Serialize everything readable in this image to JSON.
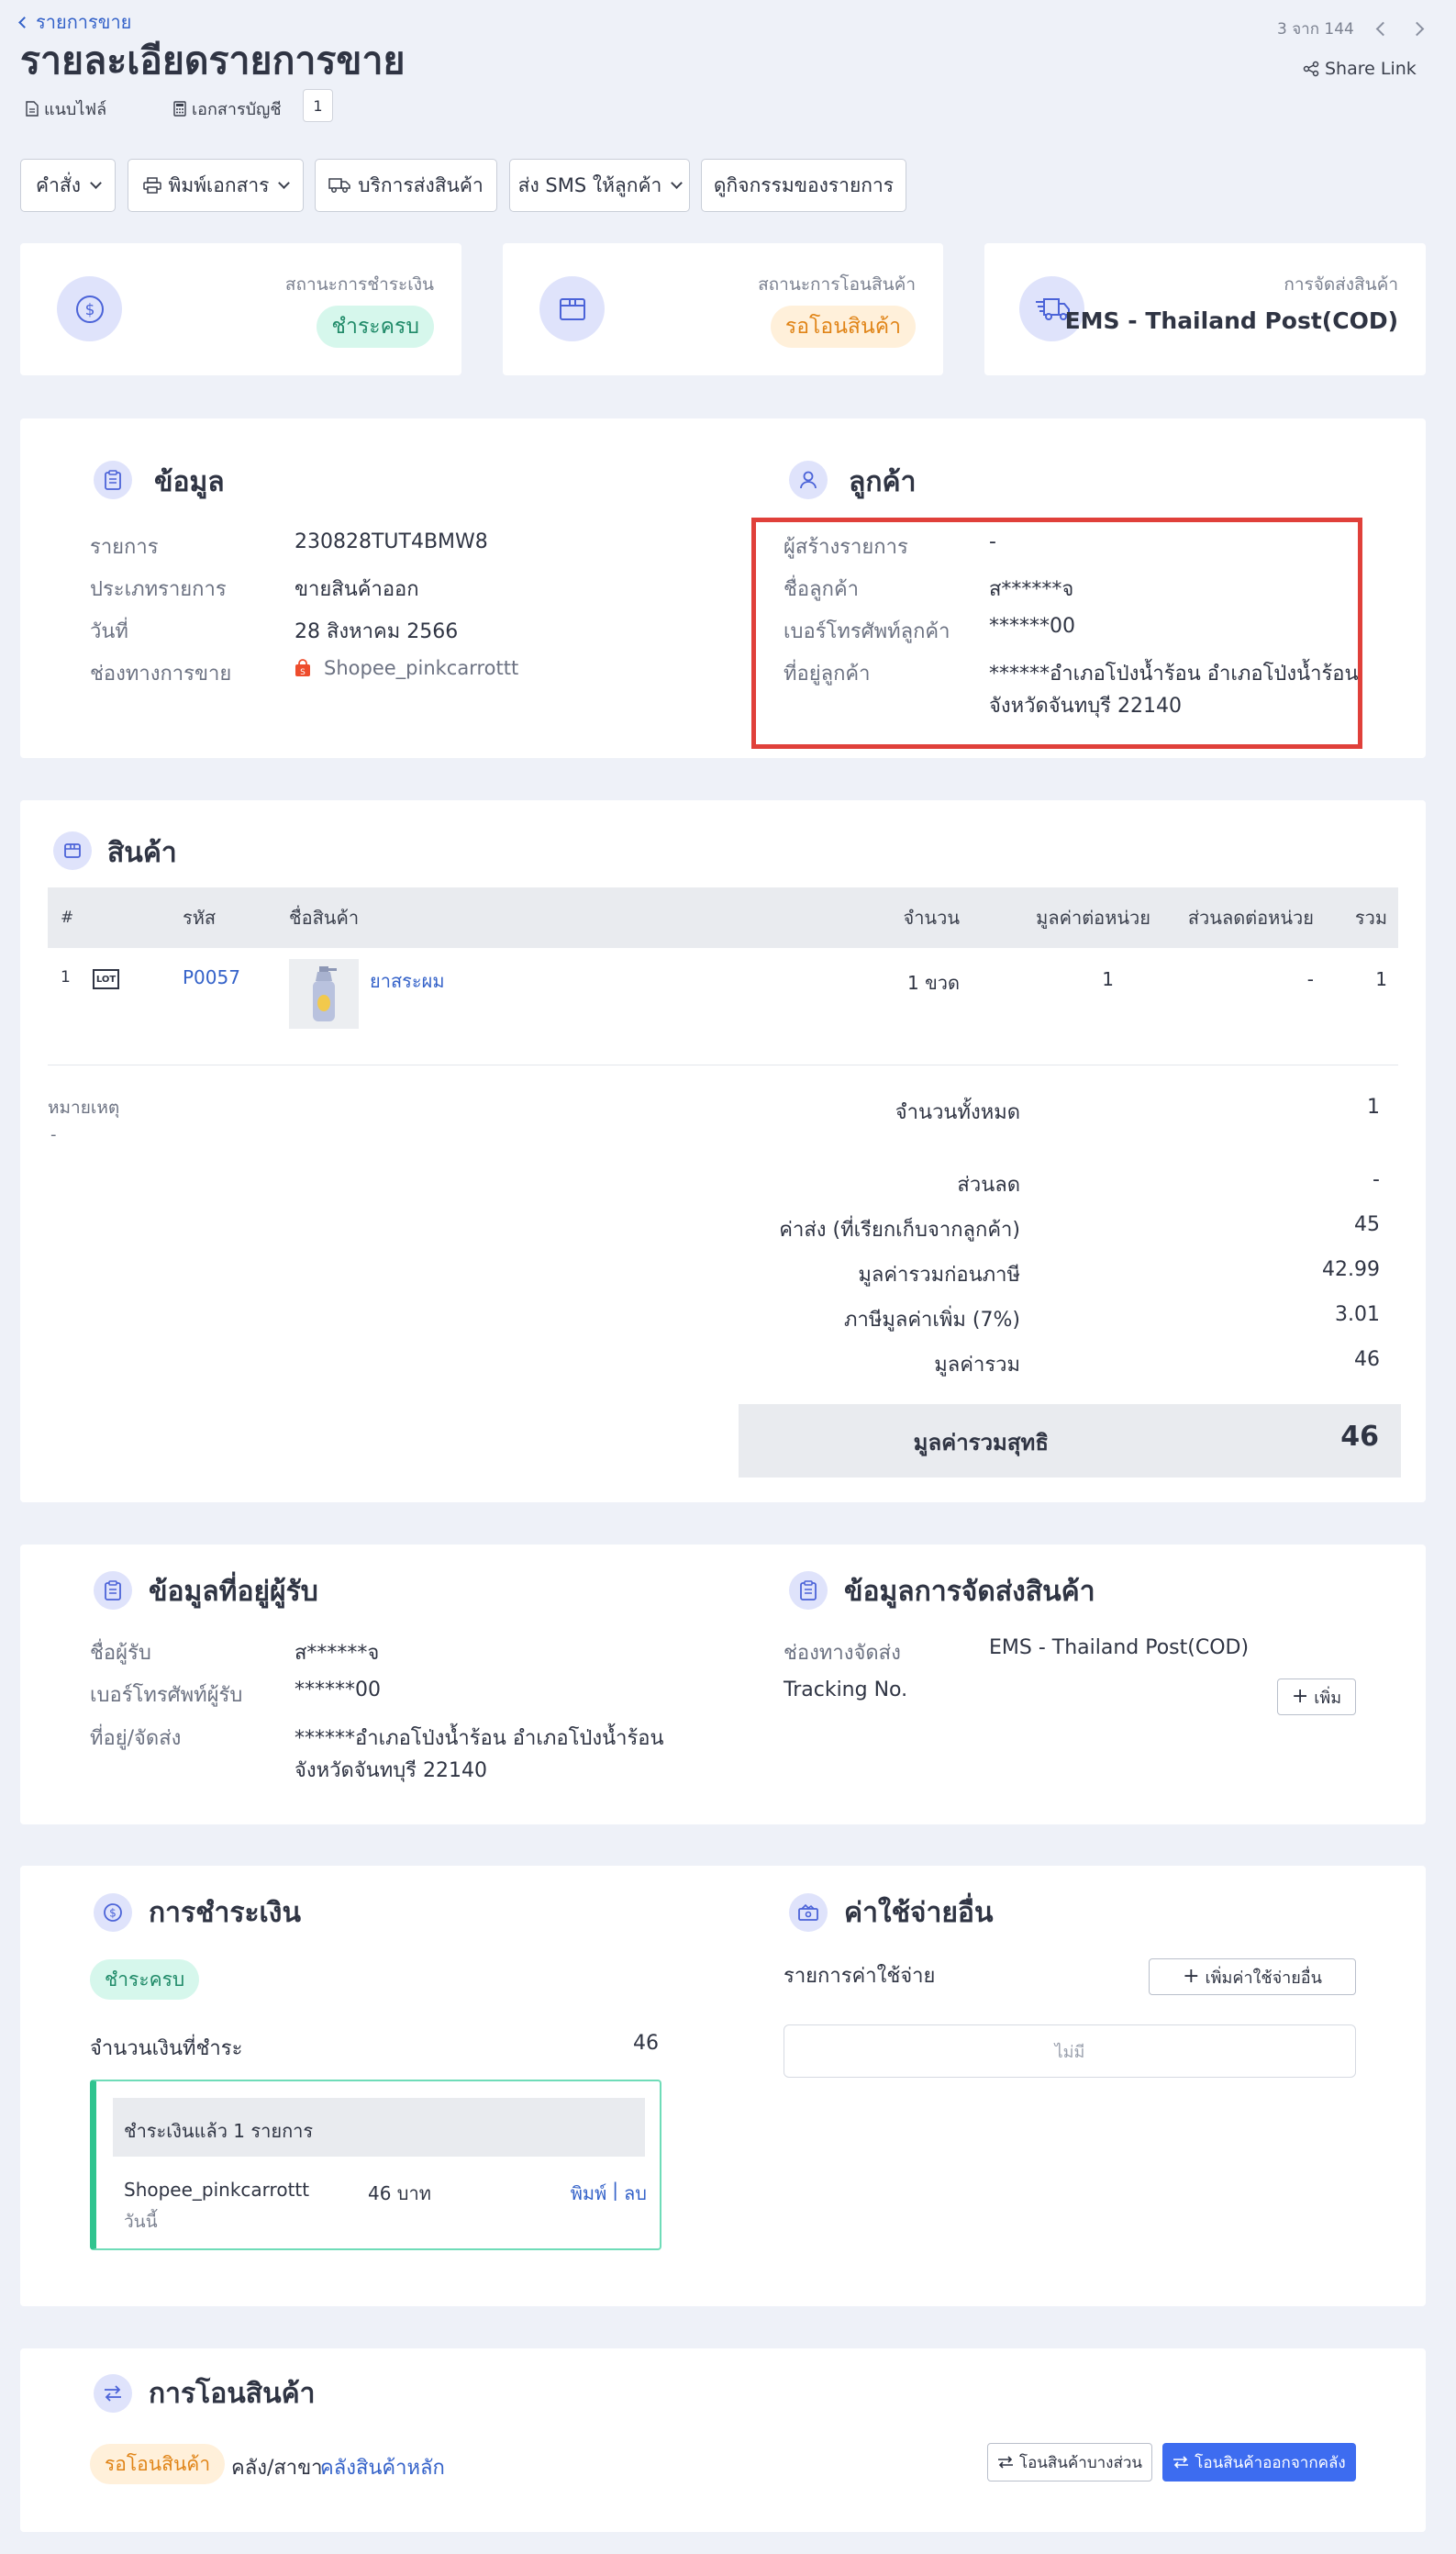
{
  "header": {
    "breadcrumb": "รายการขาย",
    "title": "รายละเอียดรายการขาย",
    "pager": "3 จาก 144",
    "share_link": "Share Link",
    "attach_label": "แนบไฟล์",
    "doc_label": "เอกสารบัญชี",
    "doc_count": "1"
  },
  "toolbar": {
    "command": "คำสั่ง",
    "print": "พิมพ์เอกสาร",
    "shipping_service": "บริการส่งสินค้า",
    "sms": "ส่ง SMS ให้ลูกค้า",
    "activity": "ดูกิจกรรมของรายการ"
  },
  "status": {
    "payment_label": "สถานะการชำระเงิน",
    "payment_value": "ชำระครบ",
    "transfer_label": "สถานะการโอนสินค้า",
    "transfer_value": "รอโอนสินค้า",
    "shipping_label": "การจัดส่งสินค้า",
    "shipping_value": "EMS - Thailand Post(COD)"
  },
  "info": {
    "title": "ข้อมูล",
    "rows": [
      {
        "label": "รายการ",
        "value": "230828TUT4BMW8"
      },
      {
        "label": "ประเภทรายการ",
        "value": "ขายสินค้าออก"
      },
      {
        "label": "วันที่",
        "value": "28 สิงหาคม 2566"
      },
      {
        "label": "ช่องทางการขาย",
        "value": "Shopee_pinkcarrottt"
      }
    ]
  },
  "customer": {
    "title": "ลูกค้า",
    "rows": [
      {
        "label": "ผู้สร้างรายการ",
        "value": "-"
      },
      {
        "label": "ชื่อลูกค้า",
        "value": "ส******จ"
      },
      {
        "label": "เบอร์โทรศัพท์ลูกค้า",
        "value": "******00"
      },
      {
        "label": "ที่อยู่ลูกค้า",
        "value": "******อำเภอโป่งน้ำร้อน อำเภอโป่งน้ำร้อน",
        "value2": "จังหวัดจันทบุรี 22140"
      }
    ]
  },
  "products": {
    "title": "สินค้า",
    "headers": {
      "no": "#",
      "code": "รหัส",
      "name": "ชื่อสินค้า",
      "qty": "จำนวน",
      "unit_price": "มูลค่าต่อหน่วย",
      "discount": "ส่วนลดต่อหน่วย",
      "total": "รวม"
    },
    "rows": [
      {
        "no": "1",
        "lot": "LOT",
        "code": "P0057",
        "name": "ยาสระผม",
        "qty": "1 ขวด",
        "unit_price": "1",
        "discount": "-",
        "total": "1"
      }
    ],
    "note_label": "หมายเหตุ",
    "note_value": "-",
    "summary": [
      {
        "label": "จำนวนทั้งหมด",
        "value": "1"
      },
      {
        "label": "ส่วนลด",
        "value": "-"
      },
      {
        "label": "ค่าส่ง (ที่เรียกเก็บจากลูกค้า)",
        "value": "45"
      },
      {
        "label": "มูลค่ารวมก่อนภาษี",
        "value": "42.99"
      },
      {
        "label": "ภาษีมูลค่าเพิ่ม (7%)",
        "value": "3.01"
      },
      {
        "label": "มูลค่ารวม",
        "value": "46"
      }
    ],
    "net_label": "มูลค่ารวมสุทธิ",
    "net_value": "46"
  },
  "recipient": {
    "title": "ข้อมูลที่อยู่ผู้รับ",
    "rows": [
      {
        "label": "ชื่อผู้รับ",
        "value": "ส******จ"
      },
      {
        "label": "เบอร์โทรศัพท์ผู้รับ",
        "value": "******00"
      },
      {
        "label": "ที่อยู่/จัดส่ง",
        "value": "******อำเภอโป่งน้ำร้อน อำเภอโป่งน้ำร้อน",
        "value2": "จังหวัดจันทบุรี 22140"
      }
    ]
  },
  "shipping": {
    "title": "ข้อมูลการจัดส่งสินค้า",
    "channel_label": "ช่องทางจัดส่ง",
    "channel_value": "EMS - Thailand Post(COD)",
    "tracking_label": "Tracking No.",
    "add_button": "เพิ่ม"
  },
  "payment": {
    "title": "การชำระเงิน",
    "status": "ชำระครบ",
    "amount_label": "จำนวนเงินที่ชำระ",
    "amount_value": "46",
    "paid_header": "ชำระเงินแล้ว 1 รายการ",
    "entry_channel": "Shopee_pinkcarrottt",
    "entry_amount": "46 บาท",
    "entry_date": "วันนี้",
    "print_link": "พิมพ์",
    "separator": "|",
    "delete_link": "ลบ"
  },
  "expenses": {
    "title": "ค่าใช้จ่ายอื่น",
    "list_label": "รายการค่าใช้จ่าย",
    "add_button": "เพิ่มค่าใช้จ่ายอื่น",
    "empty": "ไม่มี"
  },
  "transfer": {
    "title": "การโอนสินค้า",
    "status": "รอโอนสินค้า",
    "warehouse_label": "คลัง/สาขา",
    "warehouse_value": "คลังสินค้าหลัก",
    "partial_button": "โอนสินค้าบางส่วน",
    "transfer_button": "โอนสินค้าออกจากคลัง"
  },
  "colors": {
    "accent": "#3462c9",
    "primary_button": "#3d6cf0",
    "highlight_border": "#e0403a",
    "success": "#1f8a68",
    "warning": "#e08417"
  }
}
